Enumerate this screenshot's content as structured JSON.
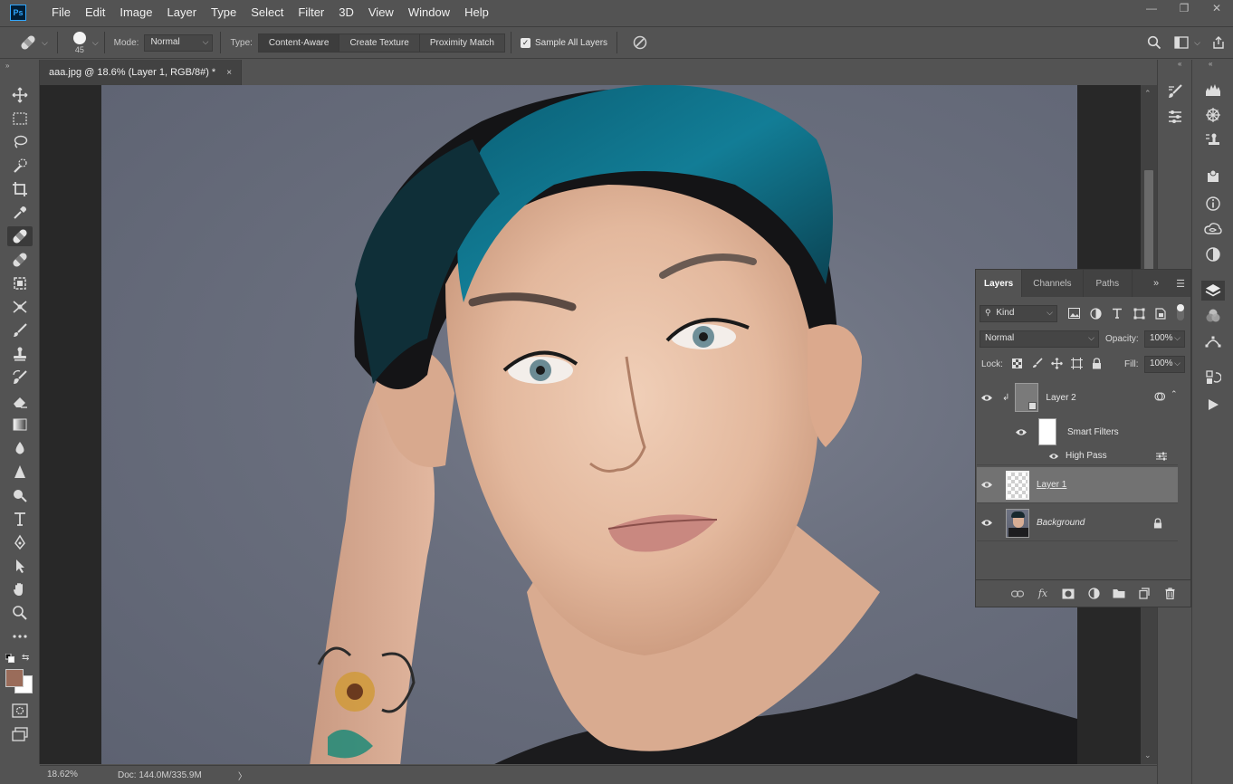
{
  "app": {
    "logo": "Ps"
  },
  "menu": [
    "File",
    "Edit",
    "Image",
    "Layer",
    "Type",
    "Select",
    "Filter",
    "3D",
    "View",
    "Window",
    "Help"
  ],
  "window_controls": {
    "minimize": "—",
    "restore": "❐",
    "close": "✕"
  },
  "options": {
    "brush_size": "45",
    "mode_label": "Mode:",
    "mode_value": "Normal",
    "type_label": "Type:",
    "type_options": [
      "Content-Aware",
      "Create Texture",
      "Proximity Match"
    ],
    "sample_all_layers": "Sample All Layers"
  },
  "document": {
    "tab_title": "aaa.jpg @ 18.6% (Layer 1, RGB/8#) *",
    "tab_close": "×"
  },
  "status": {
    "zoom": "18.62%",
    "doc_info": "Doc: 144.0M/335.9M",
    "arrow": "〉"
  },
  "layers_panel": {
    "tabs": [
      "Layers",
      "Channels",
      "Paths"
    ],
    "filter_kind": "Kind",
    "blend_mode": "Normal",
    "opacity_label": "Opacity:",
    "opacity_value": "100%",
    "lock_label": "Lock:",
    "fill_label": "Fill:",
    "fill_value": "100%",
    "layers": [
      {
        "name": "Layer 2"
      },
      {
        "name": "Smart Filters"
      },
      {
        "name": "High Pass"
      },
      {
        "name": "Layer 1"
      },
      {
        "name": "Background"
      }
    ]
  },
  "colors": {
    "foreground": "#9a6c5a",
    "background": "#ffffff",
    "accent": "#31a8ff"
  }
}
